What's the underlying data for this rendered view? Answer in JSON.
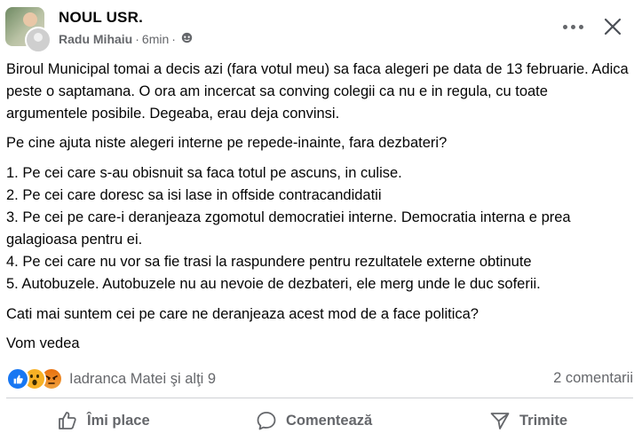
{
  "post": {
    "group_name": "NOUL USR.",
    "author": "Radu Mihaiu",
    "time": "6min",
    "separator": "·",
    "paragraphs": [
      "Biroul Municipal tomai a decis azi (fara votul meu) sa faca alegeri pe data de 13 februarie. Adica peste o saptamana. O ora am incercat sa conving colegii ca nu e in regula, cu toate argumentele posibile. Degeaba, erau deja convinsi.",
      "Pe cine ajuta niste alegeri interne pe repede-inainte, fara dezbateri?"
    ],
    "list": [
      "1. Pe cei care s-au obisnuit sa faca totul pe ascuns, in culise.",
      "2.  Pe cei care doresc sa isi lase in offside contracandidatii",
      "3. Pe cei pe care-i deranjeaza zgomotul democratiei interne. Democratia interna e prea galagioasa pentru ei.",
      "4. Pe cei care nu vor sa fie trasi la raspundere pentru rezultatele externe obtinute",
      "5. Autobuzele. Autobuzele nu au nevoie de dezbateri, ele merg unde le duc soferii."
    ],
    "question": "Cati mai suntem cei pe care ne deranjeaza acest mod de a face politica?",
    "closing": "Vom vedea"
  },
  "footer": {
    "reactors": "Iadranca Matei şi alţi 9",
    "comments": "2 comentarii",
    "like_label": "Îmi place",
    "comment_label": "Comentează",
    "share_label": "Trimite"
  },
  "icons": {
    "like": "like-icon",
    "wow": "wow-icon",
    "angry": "angry-icon",
    "globe": "globe-icon",
    "more": "more-icon",
    "close": "close-icon",
    "comment": "comment-icon",
    "share": "share-icon"
  },
  "colors": {
    "text": "#050505",
    "muted": "#65676b",
    "like_blue": "#1877f2",
    "divider": "#ced0d4"
  }
}
